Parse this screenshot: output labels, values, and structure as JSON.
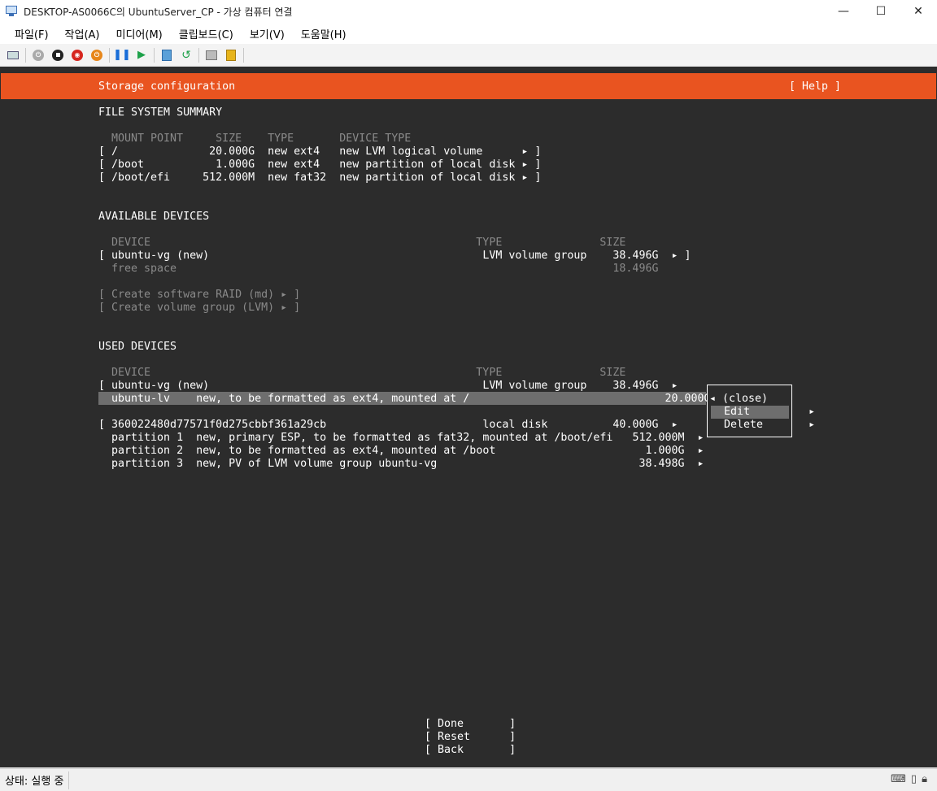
{
  "window": {
    "title": "DESKTOP-AS0066C의 UbuntuServer_CP - 가상 컴퓨터 연결",
    "minimize": "—",
    "maximize": "☐",
    "close": "✕"
  },
  "menu": [
    "파일(F)",
    "작업(A)",
    "미디어(M)",
    "클립보드(C)",
    "보기(V)",
    "도움말(H)"
  ],
  "installer": {
    "header_title": "Storage configuration",
    "help": "[ Help ]",
    "fs_summary": {
      "heading": "FILE SYSTEM SUMMARY",
      "columns": "MOUNT POINT     SIZE    TYPE       DEVICE TYPE",
      "rows": [
        "[ /              20.000G  new ext4   new LVM logical volume      ▸ ]",
        "[ /boot           1.000G  new ext4   new partition of local disk ▸ ]",
        "[ /boot/efi     512.000M  new fat32  new partition of local disk ▸ ]"
      ]
    },
    "available": {
      "heading": "AVAILABLE DEVICES",
      "columns": "DEVICE                                                  TYPE               SIZE",
      "vg_row": "[ ubuntu-vg (new)                                          LVM volume group    38.496G  ▸ ]",
      "free_row": "free space                                                                   18.496G",
      "create_raid": "[ Create software RAID (md) ▸ ]",
      "create_vg": "[ Create volume group (LVM) ▸ ]"
    },
    "used": {
      "heading": "USED DEVICES",
      "columns": "DEVICE                                                  TYPE               SIZE",
      "vg_row": "[ ubuntu-vg (new)                                          LVM volume group    38.496G  ▸",
      "lv_row": "  ubuntu-lv    new, to be formatted as ext4, mounted at /                              20.000G  ▸",
      "disk_row": "[ 360022480d77571f0d275cbbf361a29cb                        local disk          40.000G  ▸",
      "part1": "  partition 1  new, primary ESP, to be formatted as fat32, mounted at /boot/efi   512.000M  ▸",
      "part2": "  partition 2  new, to be formatted as ext4, mounted at /boot                       1.000G  ▸",
      "part3": "  partition 3  new, PV of LVM volume group ubuntu-vg                               38.498G  ▸"
    },
    "popup": {
      "close": "◂ (close)",
      "edit": " Edit         ▸",
      "delete": " Delete       ▸"
    },
    "buttons": {
      "done": "[ Done       ]",
      "reset": "[ Reset      ]",
      "back": "[ Back       ]"
    }
  },
  "status": {
    "text": "상태: 실행 중"
  }
}
